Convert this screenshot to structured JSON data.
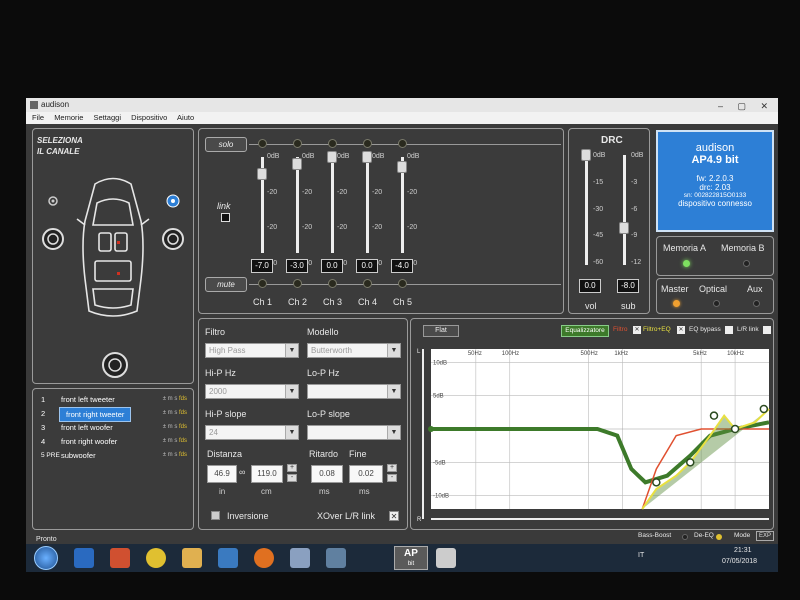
{
  "window": {
    "title": "audison"
  },
  "menu": [
    "File",
    "Memorie",
    "Settaggi",
    "Dispositivo",
    "Aiuto"
  ],
  "channel_select": {
    "title_line1": "SELEZIONA",
    "title_line2": "IL CANALE"
  },
  "mixer": {
    "solo_label": "solo",
    "mute_label": "mute",
    "link_label": "link",
    "scale": [
      "0dB",
      "-20",
      "-20",
      "-40"
    ],
    "channels": [
      {
        "name": "Ch 1",
        "value": "-7.0",
        "level_db": -7.0
      },
      {
        "name": "Ch 2",
        "value": "-3.0",
        "level_db": -3.0
      },
      {
        "name": "Ch 3",
        "value": "0.0",
        "level_db": 0.0
      },
      {
        "name": "Ch 4",
        "value": "0.0",
        "level_db": 0.0
      },
      {
        "name": "Ch 5",
        "value": "-4.0",
        "level_db": -4.0
      }
    ]
  },
  "drc": {
    "title": "DRC",
    "vol": {
      "label": "vol",
      "value": "0.0",
      "ticks": [
        "0dB",
        "-15",
        "-30",
        "-45",
        "-60"
      ],
      "level_db": 0
    },
    "sub": {
      "label": "sub",
      "value": "-8.0",
      "ticks": [
        "0dB",
        "-3",
        "-6",
        "-9",
        "-12"
      ],
      "level_db": -8
    }
  },
  "device": {
    "brand": "audison",
    "model": "AP4.9 bit",
    "fw": "fw: 2.2.0.3",
    "drc": "drc: 2.03",
    "sn": "sn: 002822815O0133",
    "status": "dispositivo connesso"
  },
  "memory": {
    "a": "Memoria A",
    "b": "Memoria B",
    "active": "a"
  },
  "inputs": {
    "master": "Master",
    "optical": "Optical",
    "aux": "Aux",
    "active": "master"
  },
  "channel_list": [
    {
      "num": "1",
      "name": "front left tweeter",
      "flags": "± m s fds"
    },
    {
      "num": "2",
      "name": "front right tweeter",
      "flags": "± m s fds",
      "selected": true
    },
    {
      "num": "3",
      "name": "front left woofer",
      "flags": "± m s fds"
    },
    {
      "num": "4",
      "name": "front right woofer",
      "flags": "± m s fds"
    },
    {
      "num": "5 PRE",
      "name": "subwoofer",
      "flags": "± m s fds"
    }
  ],
  "filter": {
    "filtro_label": "Filtro",
    "filtro_value": "High Pass",
    "modello_label": "Modello",
    "modello_value": "Butterworth",
    "hip_hz_label": "Hi-P Hz",
    "hip_hz_value": "2000",
    "lop_hz_label": "Lo-P Hz",
    "lop_hz_value": "",
    "hip_slope_label": "Hi-P slope",
    "hip_slope_value": "24",
    "lop_slope_label": "Lo-P slope",
    "lop_slope_value": "",
    "distanza_label": "Distanza",
    "dist_in": "46.9",
    "dist_cm": "119.0",
    "unit_in": "in",
    "unit_cm": "cm",
    "ritardo_label": "Ritardo",
    "ritardo_value": "0.08",
    "fine_label": "Fine",
    "fine_value": "0.02",
    "unit_ms": "ms",
    "inversione_label": "Inversione",
    "xover_label": "XOver L/R link"
  },
  "eq": {
    "flat_label": "Flat",
    "equalizzatore": "Equalizzatore",
    "filtro": "Filtro",
    "filtro_eq": "Filtro+EQ",
    "eq_bypass": "EQ bypass",
    "lr_link": "L/R link",
    "freq_labels": [
      "50Hz",
      "100Hz",
      "500Hz",
      "1kHz",
      "5kHz",
      "10kHz"
    ],
    "db_labels": [
      "10dB",
      "5dB",
      "-5dB",
      "-10dB"
    ],
    "axis_l": "L",
    "axis_r": "R"
  },
  "statusbar": {
    "left": "Pronto",
    "bass_boost": "Bass-Boost",
    "de_eq": "De-EQ",
    "mode": "Mode",
    "exp": "EXP"
  },
  "taskbar": {
    "app_label": "AP",
    "app_sub": "bit",
    "lang": "IT",
    "time": "21:31",
    "date": "07/05/2018"
  },
  "colors": {
    "accent_blue": "#2d7fd6",
    "eq_green": "#3d7a2a",
    "filter_red": "#e05030",
    "filter_eq_yellow": "#e8e040",
    "led_green": "#7ee060",
    "led_orange": "#f0a030"
  }
}
